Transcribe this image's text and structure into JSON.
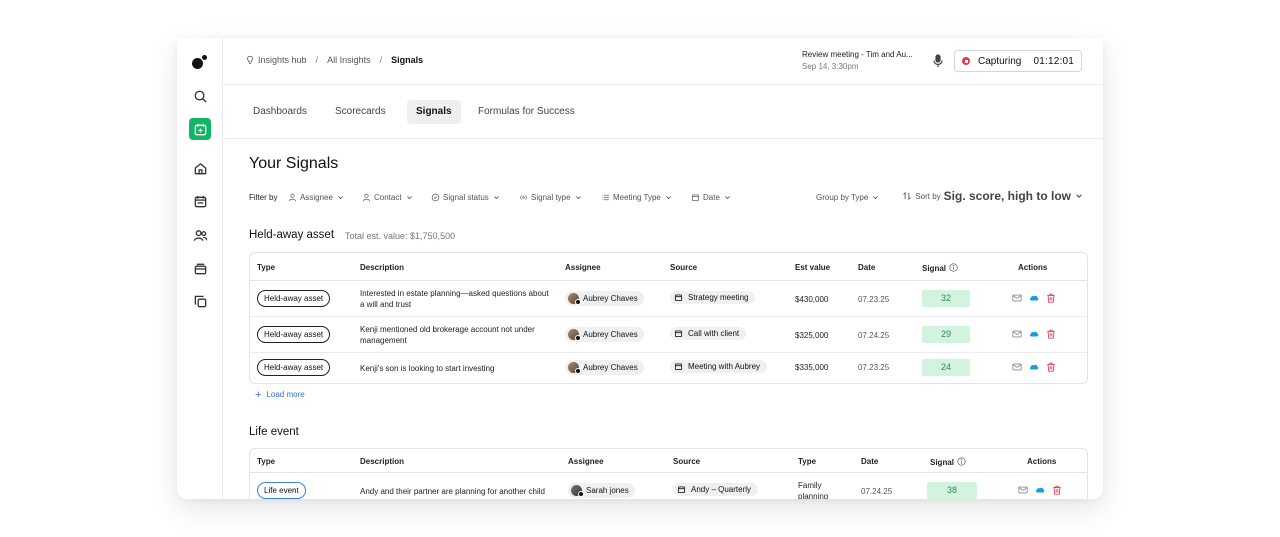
{
  "breadcrumbs": [
    "Insights hub",
    "All Insights",
    "Signals"
  ],
  "meeting": {
    "title": "Review meeting - Tim and Au...",
    "subtitle": "Sep 14, 3:30pm"
  },
  "capture": {
    "label": "Capturing",
    "time": "01:12:01",
    "status_color": "#e53b52"
  },
  "tabs": [
    {
      "label": "Dashboards"
    },
    {
      "label": "Scorecards"
    },
    {
      "label": "Signals",
      "active": true
    },
    {
      "label": "Formulas for Success"
    }
  ],
  "page_title": "Your Signals",
  "filters": {
    "label": "Filter by",
    "items": [
      "Assignee",
      "Contact",
      "Signal status",
      "Signal type",
      "Meeting Type",
      "Date"
    ],
    "group_by": "Group by Type",
    "sort_prefix": "Sort by",
    "sort_value": "Sig. score, high to low"
  },
  "sections": [
    {
      "title": "Held-away asset",
      "total": "Total est. value: $1,750,500",
      "columns": [
        "Type",
        "Description",
        "Assignee",
        "Source",
        "Est value",
        "Date",
        "Signal",
        "Actions"
      ],
      "rows": [
        {
          "type": "Held-away asset",
          "description": "Interested in estate planning—asked questions about a will and trust",
          "assignee": "Aubrey Chaves",
          "source": "Strategy meeting",
          "value": "$430,000",
          "date": "07.23.25",
          "signal": "32"
        },
        {
          "type": "Held-away asset",
          "description": "Kenji mentioned old brokerage account not under management",
          "assignee": "Aubrey Chaves",
          "source": "Call with client",
          "value": "$325,000",
          "date": "07.24.25",
          "signal": "29"
        },
        {
          "type": "Held-away asset",
          "description": "Kenji's son is looking to start investing",
          "assignee": "Aubrey Chaves",
          "source": "Meeting with Aubrey",
          "value": "$335,000",
          "date": "07.23.25",
          "signal": "24"
        }
      ],
      "load_more": "Load more"
    },
    {
      "title": "Life event",
      "columns": [
        "Type",
        "Description",
        "Assignee",
        "Source",
        "Type",
        "Date",
        "Signal",
        "Actions"
      ],
      "rows": [
        {
          "type": "Life event",
          "description": "Andy and their partner are planning for another child",
          "assignee": "Sarah jones",
          "source": "Andy – Quarterly",
          "subtype": "Family planning",
          "date": "07.24.25",
          "signal": "38"
        }
      ]
    }
  ],
  "colors": {
    "accent_green": "#12b565",
    "signal_bg": "#d2f4df",
    "signal_text": "#2e8a57",
    "link_blue": "#2f6fd6",
    "delete_red": "#e0485a",
    "salesforce_blue": "#1b9be0"
  }
}
